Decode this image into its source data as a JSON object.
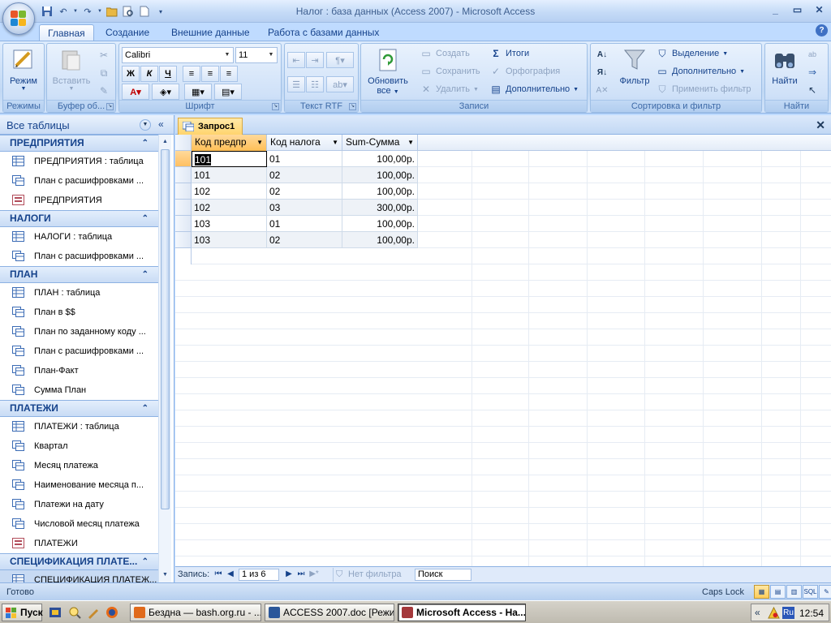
{
  "window": {
    "title": "Налог : база данных (Access 2007) - Microsoft Access",
    "controls": [
      "_",
      "▭",
      "✕"
    ]
  },
  "qat": [
    "save-icon",
    "undo-icon",
    "redo-icon",
    "open-icon",
    "print-preview-icon",
    "new-icon",
    "customize-icon"
  ],
  "tabs": [
    {
      "label": "Главная",
      "active": true
    },
    {
      "label": "Создание"
    },
    {
      "label": "Внешние данные"
    },
    {
      "label": "Работа с базами данных"
    }
  ],
  "ribbon": {
    "views": {
      "label": "Режимы",
      "button": "Режим"
    },
    "clipboard": {
      "label": "Буфер об...",
      "paste": "Вставить"
    },
    "font": {
      "label": "Шрифт",
      "family": "Calibri",
      "size": "11",
      "bold": "Ж",
      "italic": "К",
      "underline": "Ч"
    },
    "rtf": {
      "label": "Текст RTF"
    },
    "records": {
      "label": "Записи",
      "refresh": "Обновить",
      "refresh_sub": "все",
      "create": "Создать",
      "save": "Сохранить",
      "delete": "Удалить",
      "totals": "Итоги",
      "spelling": "Орфография",
      "more": "Дополнительно"
    },
    "sort": {
      "label": "Сортировка и фильтр",
      "filter": "Фильтр",
      "selection": "Выделение",
      "advanced": "Дополнительно",
      "apply": "Применить фильтр"
    },
    "find": {
      "label": "Найти",
      "find": "Найти"
    }
  },
  "nav": {
    "title": "Все таблицы",
    "groups": [
      {
        "name": "ПРЕДПРИЯТИЯ",
        "items": [
          {
            "label": "ПРЕДПРИЯТИЯ : таблица",
            "kind": "table"
          },
          {
            "label": "План с расшифровками ...",
            "kind": "query"
          },
          {
            "label": "ПРЕДПРИЯТИЯ",
            "kind": "form"
          }
        ]
      },
      {
        "name": "НАЛОГИ",
        "items": [
          {
            "label": "НАЛОГИ : таблица",
            "kind": "table"
          },
          {
            "label": "План с расшифровками ...",
            "kind": "query"
          }
        ]
      },
      {
        "name": "ПЛАН",
        "items": [
          {
            "label": "ПЛАН : таблица",
            "kind": "table"
          },
          {
            "label": "План в $$",
            "kind": "query"
          },
          {
            "label": "План по заданному коду ...",
            "kind": "query"
          },
          {
            "label": "План с расшифровками ...",
            "kind": "query"
          },
          {
            "label": "План-Факт",
            "kind": "query"
          },
          {
            "label": "Сумма План",
            "kind": "query"
          }
        ]
      },
      {
        "name": "ПЛАТЕЖИ",
        "items": [
          {
            "label": "ПЛАТЕЖИ : таблица",
            "kind": "table"
          },
          {
            "label": "Квартал",
            "kind": "query"
          },
          {
            "label": "Месяц платежа",
            "kind": "query"
          },
          {
            "label": "Наименование месяца п...",
            "kind": "query"
          },
          {
            "label": "Платежи на дату",
            "kind": "query"
          },
          {
            "label": "Числовой месяц платежа",
            "kind": "query"
          },
          {
            "label": "ПЛАТЕЖИ",
            "kind": "form"
          }
        ]
      },
      {
        "name": "СПЕЦИФИКАЦИЯ ПЛАТЕ...",
        "items": [
          {
            "label": "СПЕЦИФИКАЦИЯ ПЛАТЕЖ...",
            "kind": "table",
            "selected": true
          }
        ]
      }
    ]
  },
  "document": {
    "tab": "Запрос1",
    "columns": [
      "Код предпр",
      "Код налога",
      "Sum-Сумма"
    ],
    "rows": [
      [
        "101",
        "01",
        "100,00р."
      ],
      [
        "101",
        "02",
        "100,00р."
      ],
      [
        "102",
        "02",
        "100,00р."
      ],
      [
        "102",
        "03",
        "300,00р."
      ],
      [
        "103",
        "01",
        "100,00р."
      ],
      [
        "103",
        "02",
        "100,00р."
      ]
    ]
  },
  "record_nav": {
    "label": "Запись:",
    "position": "1 из 6",
    "filter": "Нет фильтра",
    "search": "Поиск"
  },
  "status": {
    "text": "Готово",
    "caps": "Caps Lock"
  },
  "taskbar": {
    "start": "Пуск",
    "tasks": [
      {
        "label": "Бездна — bash.org.ru - ...",
        "color": "#e06a1b"
      },
      {
        "label": "ACCESS 2007.doc [Режи...",
        "color": "#2b579a"
      },
      {
        "label": "Microsoft Access - На...",
        "color": "#a4373a",
        "active": true
      }
    ],
    "lang": "Ru",
    "time": "12:54"
  }
}
